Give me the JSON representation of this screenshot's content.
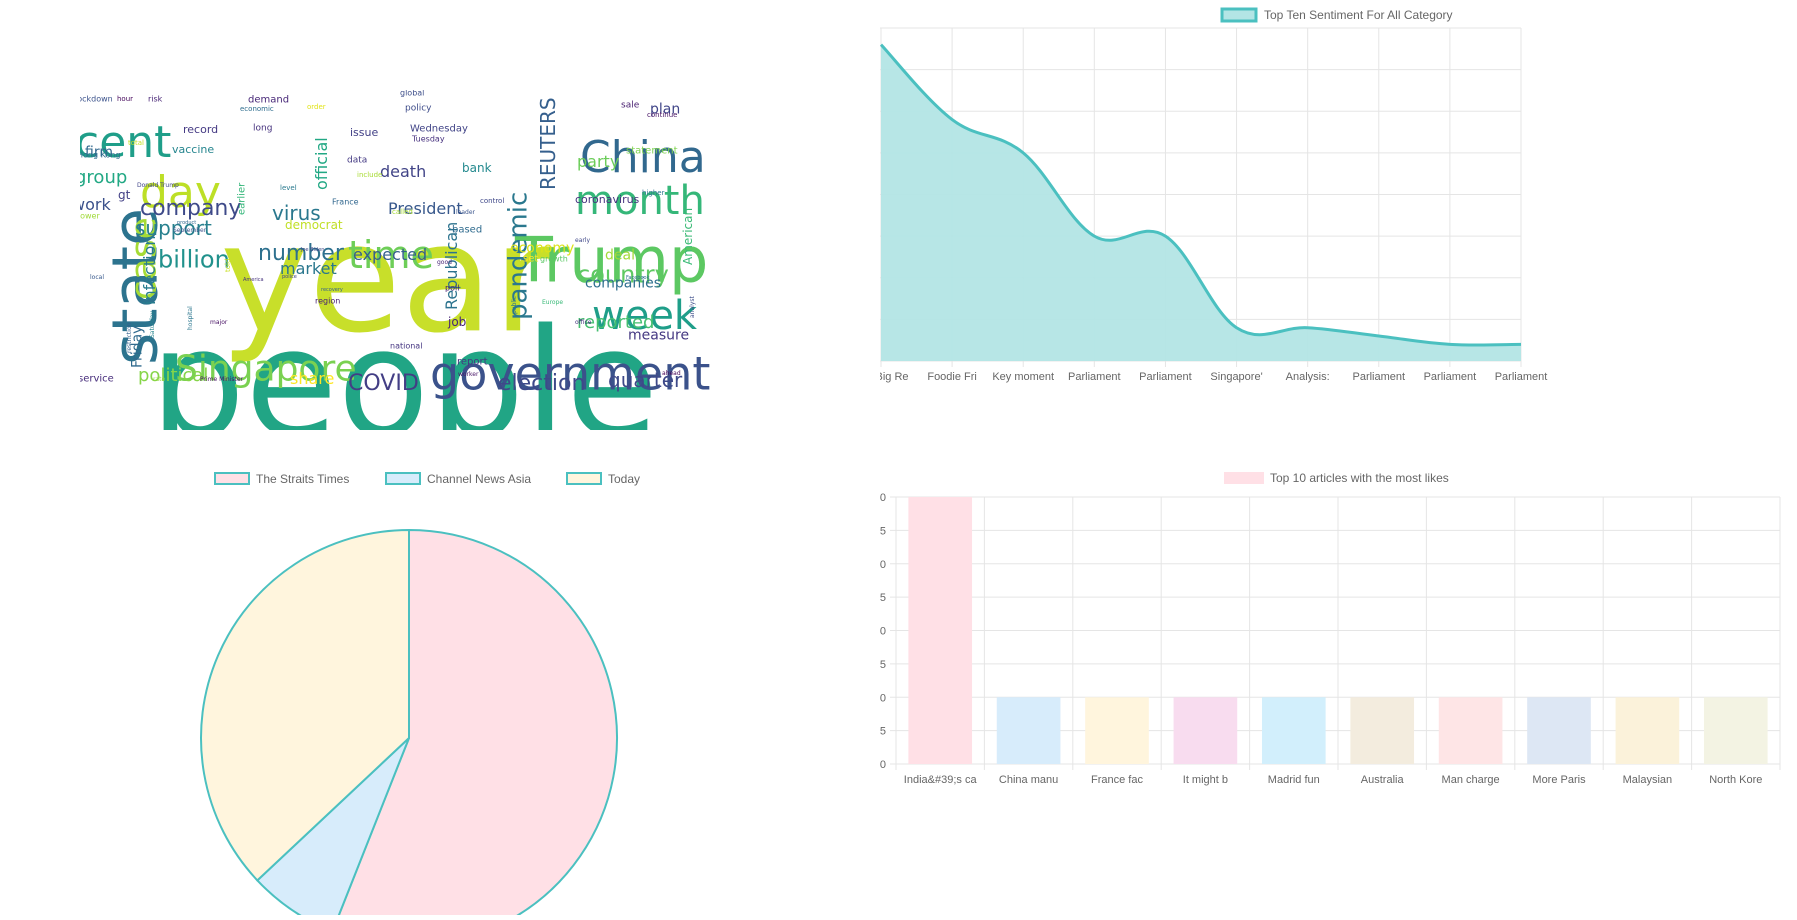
{
  "wordcloud": {
    "words": [
      {
        "text": "year",
        "size": 150,
        "color": "#c8df2a"
      },
      {
        "text": "people",
        "size": 150,
        "color": "#21a585"
      },
      {
        "text": "Trump",
        "size": 62,
        "color": "#5cc862"
      },
      {
        "text": "state",
        "size": 62,
        "color": "#2c738e"
      },
      {
        "text": "government",
        "size": 46,
        "color": "#3b528b"
      },
      {
        "text": "China",
        "size": 44,
        "color": "#31688e"
      },
      {
        "text": "cent",
        "size": 44,
        "color": "#1f9e89"
      },
      {
        "text": "day",
        "size": 44,
        "color": "#bddf26"
      },
      {
        "text": "month",
        "size": 40,
        "color": "#35b779"
      },
      {
        "text": "week",
        "size": 40,
        "color": "#1f9e89"
      },
      {
        "text": "time",
        "size": 38,
        "color": "#6ece58"
      },
      {
        "text": "Singapore",
        "size": 36,
        "color": "#7ad151"
      },
      {
        "text": "case",
        "size": 36,
        "color": "#a5db36"
      },
      {
        "text": "pandemic",
        "size": 26,
        "color": "#2a788e"
      },
      {
        "text": "billion",
        "size": 24,
        "color": "#21918c"
      },
      {
        "text": "country",
        "size": 24,
        "color": "#5ec962"
      },
      {
        "text": "company",
        "size": 22,
        "color": "#3e4a89"
      },
      {
        "text": "COVID",
        "size": 22,
        "color": "#433e85"
      },
      {
        "text": "election",
        "size": 22,
        "color": "#3e4989"
      },
      {
        "text": "number",
        "size": 22,
        "color": "#2d708e"
      },
      {
        "text": "quarter",
        "size": 20,
        "color": "#3e4989"
      },
      {
        "text": "REUTERS",
        "size": 20,
        "color": "#355f8d"
      },
      {
        "text": "support",
        "size": 20,
        "color": "#27808e"
      },
      {
        "text": "virus",
        "size": 20,
        "color": "#2a788e"
      },
      {
        "text": "group",
        "size": 18,
        "color": "#22a884"
      },
      {
        "text": "political",
        "size": 18,
        "color": "#86d549"
      },
      {
        "text": "reported",
        "size": 18,
        "color": "#44bf70"
      },
      {
        "text": "market",
        "size": 16,
        "color": "#2a778e"
      },
      {
        "text": "President",
        "size": 16,
        "color": "#38588c"
      },
      {
        "text": "expected",
        "size": 16,
        "color": "#355f8d"
      },
      {
        "text": "work",
        "size": 16,
        "color": "#3b518b"
      },
      {
        "text": "death",
        "size": 16,
        "color": "#414487"
      },
      {
        "text": "share",
        "size": 16,
        "color": "#fde725"
      },
      {
        "text": "infection",
        "size": 16,
        "color": "#287c8e"
      },
      {
        "text": "Republican",
        "size": 16,
        "color": "#2c738e"
      },
      {
        "text": "official",
        "size": 16,
        "color": "#22a884"
      },
      {
        "text": "party",
        "size": 16,
        "color": "#6ccd5a"
      },
      {
        "text": "companies",
        "size": 14,
        "color": "#2e6f8e"
      },
      {
        "text": "measure",
        "size": 14,
        "color": "#453882"
      },
      {
        "text": "Friday",
        "size": 14,
        "color": "#306a8e"
      },
      {
        "text": "plan",
        "size": 14,
        "color": "#404588"
      },
      {
        "text": "firm",
        "size": 14,
        "color": "#31688e"
      },
      {
        "text": "economy",
        "size": 14,
        "color": "#dde318"
      },
      {
        "text": "democrat",
        "size": 12,
        "color": "#c0df25"
      },
      {
        "text": "deal",
        "size": 14,
        "color": "#a2da37"
      },
      {
        "text": "American",
        "size": 12,
        "color": "#3aba76"
      },
      {
        "text": "job",
        "size": 12,
        "color": "#482475"
      },
      {
        "text": "bank",
        "size": 12,
        "color": "#23898e"
      },
      {
        "text": "coronavirus",
        "size": 11,
        "color": "#46337f"
      },
      {
        "text": "vaccine",
        "size": 11,
        "color": "#25858e"
      },
      {
        "text": "record",
        "size": 11,
        "color": "#443983"
      },
      {
        "text": "issue",
        "size": 11,
        "color": "#424086"
      },
      {
        "text": "demand",
        "size": 10,
        "color": "#482878"
      },
      {
        "text": "report",
        "size": 10,
        "color": "#453781"
      },
      {
        "text": "service",
        "size": 10,
        "color": "#472d7b"
      },
      {
        "text": "statement",
        "size": 10,
        "color": "#7fd34e"
      },
      {
        "text": "Wednesday",
        "size": 10,
        "color": "#414487"
      },
      {
        "text": "based",
        "size": 10,
        "color": "#2f6b8e"
      },
      {
        "text": "set",
        "size": 10,
        "color": "#fde725"
      },
      {
        "text": "earlier",
        "size": 10,
        "color": "#34b679"
      },
      {
        "text": "gt",
        "size": 12,
        "color": "#424086"
      },
      {
        "text": "data",
        "size": 9,
        "color": "#443a83"
      },
      {
        "text": "policy",
        "size": 9,
        "color": "#3e4c8a"
      },
      {
        "text": "long",
        "size": 9,
        "color": "#46327e"
      },
      {
        "text": "Hong Kong",
        "size": 8,
        "color": "#2e6e8e"
      },
      {
        "text": "lockdown",
        "size": 8,
        "color": "#3b528b"
      },
      {
        "text": "region",
        "size": 8,
        "color": "#482173"
      },
      {
        "text": "growth",
        "size": 8,
        "color": "#5ac864"
      },
      {
        "text": "France",
        "size": 8,
        "color": "#31678e"
      },
      {
        "text": "national",
        "size": 8,
        "color": "#453581"
      },
      {
        "text": "poll",
        "size": 8,
        "color": "#481c6e"
      },
      {
        "text": "risk",
        "size": 8,
        "color": "#482576"
      },
      {
        "text": "Tuesday",
        "size": 8,
        "color": "#46307e"
      },
      {
        "text": "include",
        "size": 7,
        "color": "#a8db34"
      },
      {
        "text": "higher",
        "size": 7,
        "color": "#2b758e"
      },
      {
        "text": "control",
        "size": 7,
        "color": "#3f4889"
      },
      {
        "text": "sale",
        "size": 9,
        "color": "#481f70"
      },
      {
        "text": "continue",
        "size": 7,
        "color": "#471365"
      },
      {
        "text": "hour",
        "size": 7,
        "color": "#46085c"
      },
      {
        "text": "economic",
        "size": 7,
        "color": "#2e6d8e"
      },
      {
        "text": "level",
        "size": 7,
        "color": "#29798e"
      },
      {
        "text": "called",
        "size": 7,
        "color": "#a8db34"
      },
      {
        "text": "global",
        "size": 8,
        "color": "#3d4e8a"
      },
      {
        "text": "order",
        "size": 7,
        "color": "#e2e418"
      },
      {
        "text": "total",
        "size": 7,
        "color": "#c2df23"
      },
      {
        "text": "Donald Trump",
        "size": 6,
        "color": "#404588"
      },
      {
        "text": "September",
        "size": 6,
        "color": "#3b528b"
      },
      {
        "text": "Prime Minister",
        "size": 6,
        "color": "#471063"
      },
      {
        "text": "rate",
        "size": 6,
        "color": "#95d840"
      },
      {
        "text": "told",
        "size": 7,
        "color": "#c8e020"
      },
      {
        "text": "local",
        "size": 6,
        "color": "#38598c"
      },
      {
        "text": "power",
        "size": 8,
        "color": "#a0da39"
      },
      {
        "text": "restriction",
        "size": 6,
        "color": "#34618d"
      },
      {
        "text": "Saturday",
        "size": 6,
        "color": "#25848e"
      },
      {
        "text": "hospital",
        "size": 6,
        "color": "#2a768e"
      },
      {
        "text": "major",
        "size": 6,
        "color": "#471164"
      },
      {
        "text": "leader",
        "size": 6,
        "color": "#3a548c"
      },
      {
        "text": "public",
        "size": 6,
        "color": "#2b748e"
      },
      {
        "text": "Europe",
        "size": 6,
        "color": "#38b977"
      },
      {
        "text": "worker",
        "size": 6,
        "color": "#481668"
      },
      {
        "text": "analyst",
        "size": 6,
        "color": "#3d4d8a"
      },
      {
        "text": "ahead",
        "size": 6,
        "color": "#440154"
      },
      {
        "text": "office",
        "size": 6,
        "color": "#46327e"
      },
      {
        "text": "Facebook",
        "size": 5,
        "color": "#2d708e"
      },
      {
        "text": "police",
        "size": 5,
        "color": "#3f4788"
      },
      {
        "text": "product",
        "size": 5,
        "color": "#31688e"
      },
      {
        "text": "Joe Biden",
        "size": 5,
        "color": "#3e4989"
      },
      {
        "text": "recovery",
        "size": 5,
        "color": "#34618d"
      },
      {
        "text": "America",
        "size": 5,
        "color": "#46337f"
      },
      {
        "text": "good",
        "size": 6,
        "color": "#482677"
      },
      {
        "text": "early",
        "size": 6,
        "color": "#3f4788"
      }
    ]
  },
  "area_chart": {
    "legend_label": "Top Ten Sentiment For All Category",
    "color_line": "#4bc0c0",
    "color_fill": "#b3e5e5"
  },
  "pie_chart": {
    "border_color": "#4bc0c0"
  },
  "bar_chart": {
    "legend_label": "Top 10 articles with the most likes",
    "legend_color": "#ffe0e6"
  },
  "chart_data": [
    {
      "type": "area",
      "title": "",
      "categories": [
        "The Big Re",
        "Foodie Fri",
        "Key moment",
        "Parliament",
        "Parliament",
        "Singapore'",
        "Analysis:",
        "Parliament",
        "Parliament",
        "Parliament"
      ],
      "series": [
        {
          "name": "Top Ten Sentiment For All Category",
          "values": [
            88,
            79,
            75,
            65,
            65,
            54,
            54,
            53,
            52,
            52
          ]
        }
      ],
      "ylim": [
        50,
        90
      ],
      "yticks": [
        50,
        55,
        60,
        65,
        70,
        75,
        80,
        85,
        90
      ],
      "grid": true,
      "legend": "top"
    },
    {
      "type": "pie",
      "title": "",
      "labels": [
        "The Straits Times",
        "Channel News Asia",
        "Today"
      ],
      "values": [
        56,
        7,
        37
      ],
      "colors": [
        "#ffe0e6",
        "#d7ecfb",
        "#fff5dd"
      ],
      "legend": "top"
    },
    {
      "type": "bar",
      "title": "",
      "categories": [
        "India&#39;s ca",
        "China manu",
        "France fac",
        "It might b",
        "Madrid fun",
        "Australia",
        "Man charge",
        "More Paris",
        "Malaysian",
        "North Kore"
      ],
      "series": [
        {
          "name": "Top 10 articles with the most likes",
          "values": [
            4,
            1,
            1,
            1,
            1,
            1,
            1,
            1,
            1,
            1
          ]
        }
      ],
      "colors": [
        "#ffe0e6",
        "#d7ecfb",
        "#fff5dd",
        "#f8dcef",
        "#d2effc",
        "#f3ecde",
        "#fee5e6",
        "#dde7f4",
        "#fbf2da",
        "#f3f3e3"
      ],
      "ylim": [
        0,
        4.0
      ],
      "yticks": [
        "0",
        "0.5",
        "1.0",
        "1.5",
        "2.0",
        "2.5",
        "3.0",
        "3.5",
        "4.0"
      ],
      "grid": true,
      "legend": "top"
    }
  ]
}
